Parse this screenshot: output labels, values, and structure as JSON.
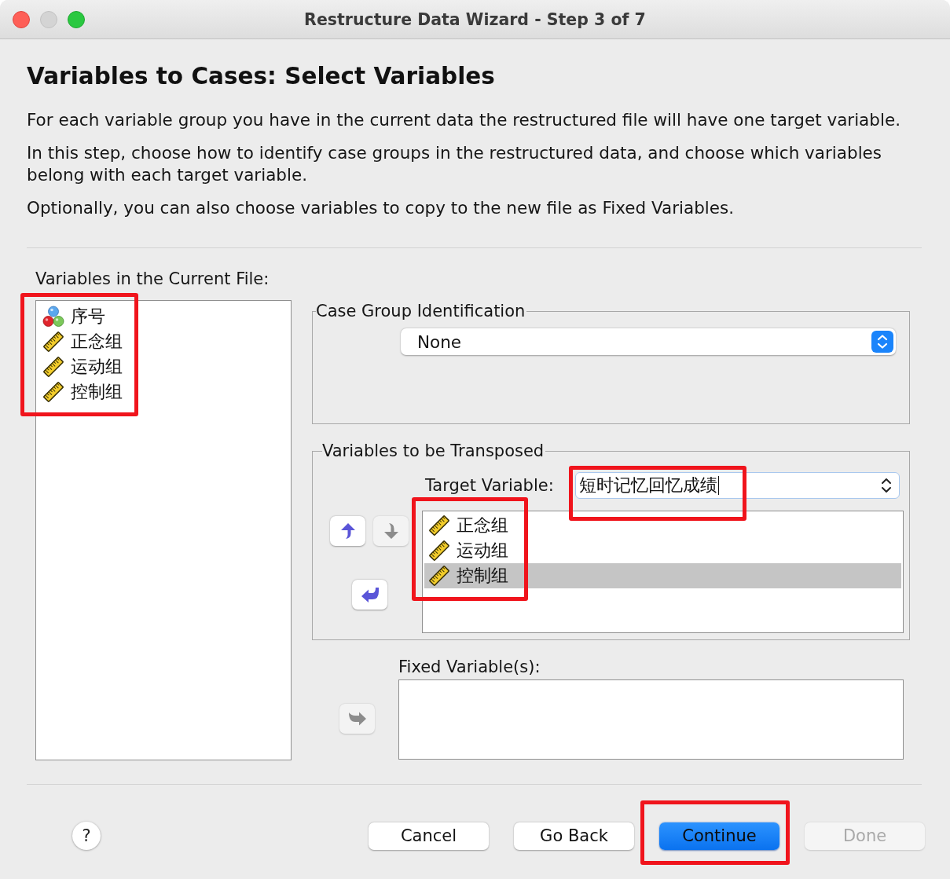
{
  "window": {
    "title": "Restructure Data Wizard - Step 3 of 7"
  },
  "heading": "Variables to Cases: Select Variables",
  "paragraphs": [
    "For each variable group you have in the current data the restructured file will have one target variable.",
    "In this step, choose how to identify case groups in the restructured data, and choose which variables belong with each target variable.",
    "Optionally, you can also choose variables to copy to the new file as Fixed Variables."
  ],
  "source_list": {
    "label": "Variables in the Current File:",
    "highlighted": true,
    "items": [
      {
        "name": "序号",
        "kind": "nominal",
        "selected": false
      },
      {
        "name": "正念组",
        "kind": "scale",
        "selected": false
      },
      {
        "name": "运动组",
        "kind": "scale",
        "selected": false
      },
      {
        "name": "控制组",
        "kind": "scale",
        "selected": false
      }
    ]
  },
  "case_group": {
    "title": "Case Group Identification",
    "select": {
      "value": "None"
    }
  },
  "transposed": {
    "title": "Variables to be Transposed",
    "target": {
      "label": "Target Variable:",
      "value": "短时记忆回忆成绩",
      "highlighted": true
    },
    "list_highlighted": true,
    "items": [
      {
        "name": "正念组",
        "kind": "scale",
        "selected": false
      },
      {
        "name": "运动组",
        "kind": "scale",
        "selected": false
      },
      {
        "name": "控制组",
        "kind": "scale",
        "selected": true
      }
    ],
    "move_up": {
      "disabled": false
    },
    "move_down": {
      "disabled": true
    },
    "move_back": {
      "disabled": false
    }
  },
  "fixed": {
    "label": "Fixed Variable(s):",
    "move_in": {
      "disabled": true
    }
  },
  "help": {
    "label": "?"
  },
  "buttons": [
    {
      "label": "Cancel",
      "kind": "normal",
      "disabled": false,
      "highlighted": false
    },
    {
      "label": "Go Back",
      "kind": "normal",
      "disabled": false,
      "highlighted": false
    },
    {
      "label": "Continue",
      "kind": "default",
      "disabled": false,
      "highlighted": true
    },
    {
      "label": "Done",
      "kind": "normal",
      "disabled": true,
      "highlighted": false
    }
  ]
}
